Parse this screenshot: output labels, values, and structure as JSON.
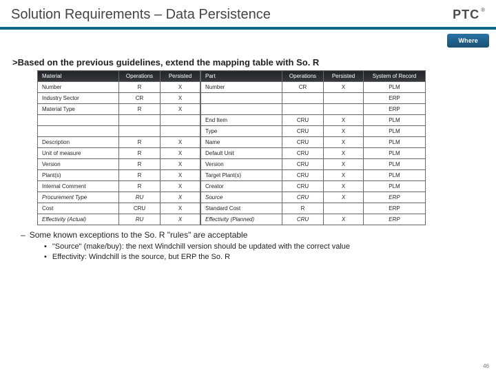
{
  "header": {
    "title": "Solution Requirements – Data Persistence",
    "logo": "PTC",
    "reg": "®"
  },
  "chip": "Where",
  "lead_marker": ">",
  "lead": "Based on the previous guidelines, extend the mapping table with So. R",
  "tblA": {
    "head": [
      "Material",
      "Operations",
      "Persisted"
    ],
    "rows": [
      {
        "c": [
          "Number",
          "R",
          "X"
        ],
        "it": false
      },
      {
        "c": [
          "Industry Sector",
          "CR",
          "X"
        ],
        "it": false
      },
      {
        "c": [
          "Material Type",
          "R",
          "X"
        ],
        "it": false
      },
      {
        "c": [
          "",
          "",
          ""
        ],
        "it": false
      },
      {
        "c": [
          "",
          "",
          ""
        ],
        "it": false
      },
      {
        "c": [
          "Description",
          "R",
          "X"
        ],
        "it": false
      },
      {
        "c": [
          "Unit of measure",
          "R",
          "X"
        ],
        "it": false
      },
      {
        "c": [
          "Version",
          "R",
          "X"
        ],
        "it": false
      },
      {
        "c": [
          "Plant(s)",
          "R",
          "X"
        ],
        "it": false
      },
      {
        "c": [
          "Internal Comment",
          "R",
          "X"
        ],
        "it": false
      },
      {
        "c": [
          "Procurement Type",
          "RU",
          "X"
        ],
        "it": true
      },
      {
        "c": [
          "Cost",
          "CRU",
          "X"
        ],
        "it": false
      },
      {
        "c": [
          "Effectivity (Actual)",
          "RU",
          "X"
        ],
        "it": true
      }
    ]
  },
  "tblB": {
    "head": [
      "Part",
      "Operations",
      "Persisted",
      "System of Record"
    ],
    "rows": [
      {
        "c": [
          "Number",
          "CR",
          "X",
          "PLM"
        ],
        "it": false
      },
      {
        "c": [
          "",
          "",
          "",
          "ERP"
        ],
        "it": false
      },
      {
        "c": [
          "",
          "",
          "",
          "ERP"
        ],
        "it": false
      },
      {
        "c": [
          "End Item",
          "CRU",
          "X",
          "PLM"
        ],
        "it": false
      },
      {
        "c": [
          "Type",
          "CRU",
          "X",
          "PLM"
        ],
        "it": false
      },
      {
        "c": [
          "Name",
          "CRU",
          "X",
          "PLM"
        ],
        "it": false
      },
      {
        "c": [
          "Default Unit",
          "CRU",
          "X",
          "PLM"
        ],
        "it": false
      },
      {
        "c": [
          "Version",
          "CRU",
          "X",
          "PLM"
        ],
        "it": false
      },
      {
        "c": [
          "Target Plant(s)",
          "CRU",
          "X",
          "PLM"
        ],
        "it": false
      },
      {
        "c": [
          "Creator",
          "CRU",
          "X",
          "PLM"
        ],
        "it": false
      },
      {
        "c": [
          "Source",
          "CRU",
          "X",
          "ERP"
        ],
        "it": true
      },
      {
        "c": [
          "Standard Cost",
          "R",
          "",
          "ERP"
        ],
        "it": false
      },
      {
        "c": [
          "Effectivity (Planned)",
          "CRU",
          "X",
          "ERP"
        ],
        "it": true
      }
    ]
  },
  "notes": {
    "dash": "Some known exceptions to the So. R \"rules\" are acceptable",
    "bullets": [
      "\"Source\" (make/buy): the next Windchill version should be updated with the correct value",
      "Effectivity: Windchill is the source, but ERP the So. R"
    ]
  },
  "pagenum": "46"
}
